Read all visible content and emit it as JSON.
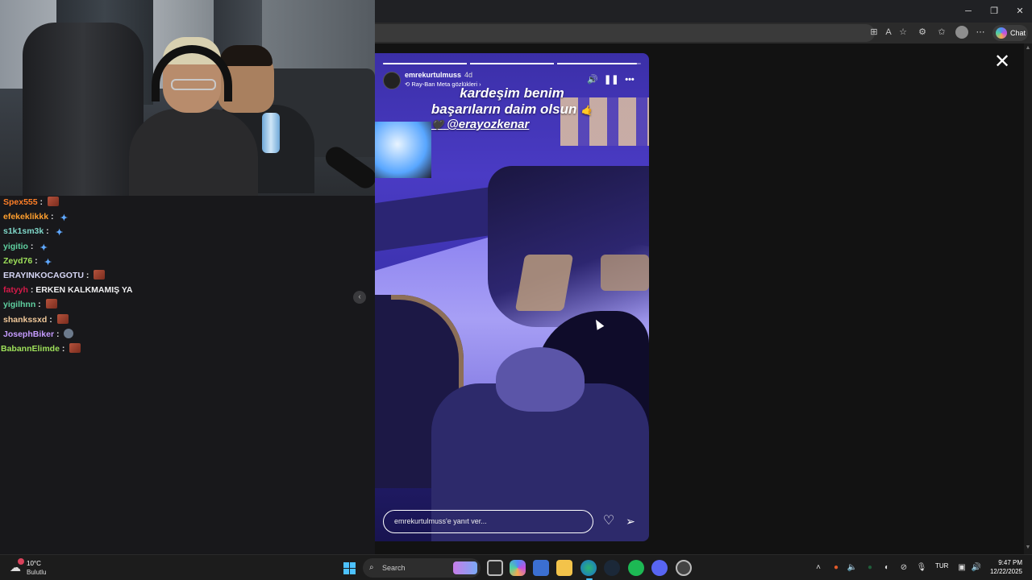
{
  "chat": {
    "messages": [
      {
        "user": "Spex555",
        "color": "#ff7f27",
        "text": "",
        "emote": "emote-red"
      },
      {
        "user": "efekeklikkk",
        "color": "#ff9f2e",
        "text": "",
        "emote": "emote-blue"
      },
      {
        "user": "s1k1sm3k",
        "color": "#7fd6c8",
        "text": "",
        "emote": "emote-blue"
      },
      {
        "user": "yigitio",
        "color": "#5fd0a0",
        "text": "",
        "emote": "emote-blue"
      },
      {
        "user": "Zeyd76",
        "color": "#9ee05a",
        "text": "",
        "emote": "emote-blue"
      },
      {
        "user": "ERAYINKOCAGOTU",
        "color": "#d6d6f5",
        "text": "",
        "emote": "emote-red"
      },
      {
        "user": "fatyyh",
        "color": "#d61a4a",
        "text": "ERKEN KALKMAMIŞ YA",
        "emote": ""
      },
      {
        "user": "yigilhnn",
        "color": "#5fd0a0",
        "text": "",
        "emote": "emote-red"
      },
      {
        "user": "shankssxd",
        "color": "#f0c89a",
        "text": "",
        "emote": "emote-red"
      },
      {
        "user": "JosephBiker",
        "color": "#c59bff",
        "text": "",
        "emote": "emote-bike"
      },
      {
        "user": "BabannElimde",
        "color": "#9ee05a",
        "text": "",
        "emote": "emote-red"
      }
    ]
  },
  "browser": {
    "chat_button": "Chat"
  },
  "story": {
    "username": "emrekurtulmuss",
    "time": "4d",
    "subtitle": "Ray-Ban Meta gözlükleri",
    "caption_line1": "kardeşim benim",
    "caption_line2": "başarıların daim olsun",
    "caption_emoji": "🤙",
    "mention_heart": "🖤",
    "mention": "@erayozkenar",
    "reply_placeholder": "emrekurtulmuss'e yanıt ver...",
    "progress": [
      1.0,
      1.0,
      0.95
    ]
  },
  "taskbar": {
    "weather_temp": "10°C",
    "weather_cond": "Bulutlu",
    "search_label": "Search",
    "language": "TUR",
    "time": "9:47 PM",
    "date": "12/22/2025"
  }
}
